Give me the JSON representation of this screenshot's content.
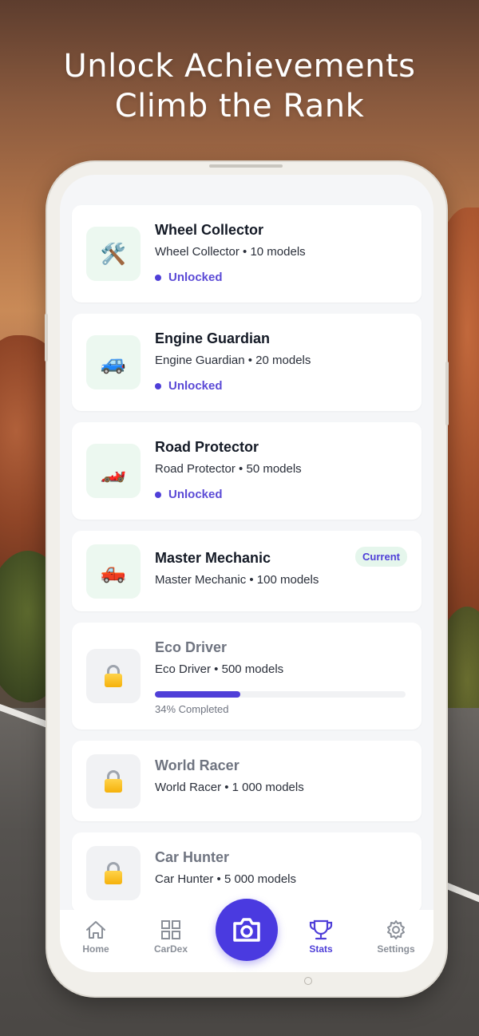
{
  "headline": {
    "line1": "Unlock Achievements",
    "line2": "Climb the Rank"
  },
  "achievements": [
    {
      "title": "Wheel Collector",
      "subtitle": "Wheel Collector • 10 models",
      "status": "Unlocked",
      "icon": "tools-icon",
      "emoji": "🛠️",
      "state": "unlocked"
    },
    {
      "title": "Engine Guardian",
      "subtitle": "Engine Guardian • 20 models",
      "status": "Unlocked",
      "icon": "car-icon",
      "emoji": "🚙",
      "state": "unlocked"
    },
    {
      "title": "Road Protector",
      "subtitle": "Road Protector • 50 models",
      "status": "Unlocked",
      "icon": "race-car-icon",
      "emoji": "🏎️",
      "state": "unlocked"
    },
    {
      "title": "Master Mechanic",
      "subtitle": "Master Mechanic • 100 models",
      "badge": "Current",
      "icon": "pickup-truck-icon",
      "emoji": "🛻",
      "state": "current"
    },
    {
      "title": "Eco Driver",
      "subtitle": "Eco Driver • 500 models",
      "progress_text": "34% Completed",
      "progress": 0.34,
      "icon": "lock-icon",
      "state": "locked"
    },
    {
      "title": "World Racer",
      "subtitle": "World Racer • 1 000 models",
      "icon": "lock-icon",
      "state": "locked"
    },
    {
      "title": "Car Hunter",
      "subtitle": "Car Hunter • 5 000 models",
      "icon": "lock-icon",
      "state": "locked"
    }
  ],
  "nav": {
    "home": "Home",
    "cardex": "CarDex",
    "camera_icon": "camera-icon",
    "stats": "Stats",
    "settings": "Settings",
    "active": "stats"
  },
  "colors": {
    "accent": "#4f3fd8",
    "unlocked_thumb": "#ecf8f0",
    "locked_thumb": "#f1f2f4",
    "badge_bg": "#e5f6ec"
  }
}
